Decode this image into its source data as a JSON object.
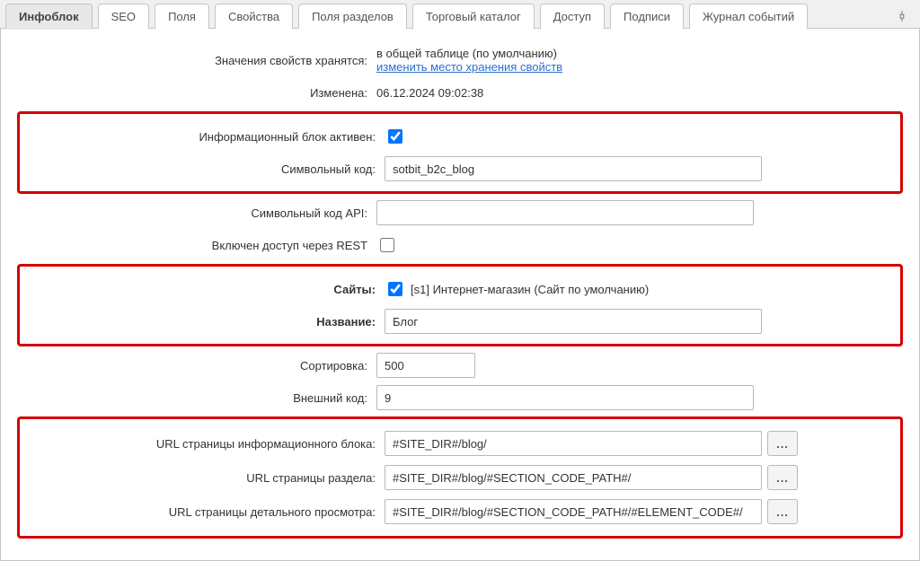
{
  "tabs": {
    "t0": "Инфоблок",
    "t1": "SEO",
    "t2": "Поля",
    "t3": "Свойства",
    "t4": "Поля разделов",
    "t5": "Торговый каталог",
    "t6": "Доступ",
    "t7": "Подписи",
    "t8": "Журнал событий"
  },
  "labels": {
    "values_stored": "Значения свойств хранятся:",
    "modified": "Изменена:",
    "active": "Информационный блок активен:",
    "code": "Символьный код:",
    "api_code": "Символьный код API:",
    "rest": "Включен доступ через REST",
    "sites": "Сайты:",
    "name": "Название:",
    "sort": "Сортировка:",
    "xml_id": "Внешний код:",
    "url_iblock": "URL страницы информационного блока:",
    "url_section": "URL страницы раздела:",
    "url_detail": "URL страницы детального просмотра:"
  },
  "values": {
    "values_stored_text": "в общей таблице (по умолчанию)",
    "change_storage_link": "изменить место хранения свойств",
    "modified": "06.12.2024 09:02:38",
    "code": "sotbit_b2c_blog",
    "api_code": "",
    "site_label": "[s1] Интернет-магазин (Сайт по умолчанию)",
    "name": "Блог",
    "sort": "500",
    "xml_id": "9",
    "url_iblock": "#SITE_DIR#/blog/",
    "url_section": "#SITE_DIR#/blog/#SECTION_CODE_PATH#/",
    "url_detail": "#SITE_DIR#/blog/#SECTION_CODE_PATH#/#ELEMENT_CODE#/",
    "ellipsis": "..."
  },
  "chk": {
    "active": true,
    "rest": false,
    "site_s1": true
  }
}
